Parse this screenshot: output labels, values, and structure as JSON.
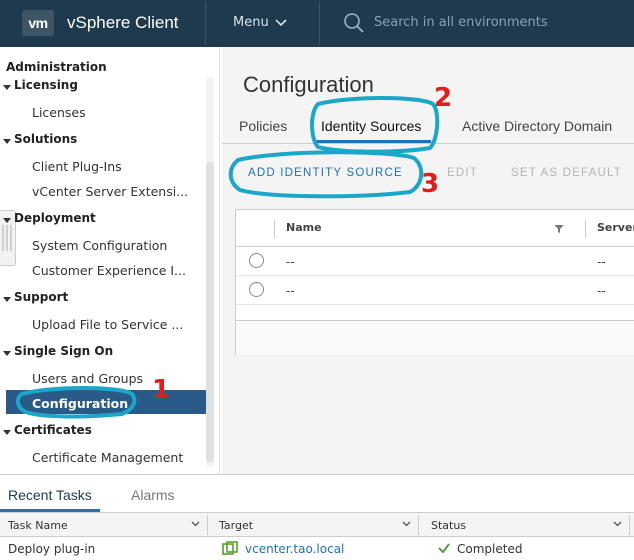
{
  "header": {
    "logo": "vm",
    "title": "vSphere Client",
    "menu_label": "Menu",
    "search_placeholder": "Search in all environments"
  },
  "sidebar": {
    "title": "Administration",
    "sections": [
      {
        "label": "Licensing",
        "items": [
          "Licenses"
        ]
      },
      {
        "label": "Solutions",
        "items": [
          "Client Plug-Ins",
          "vCenter Server Extensi..."
        ]
      },
      {
        "label": "Deployment",
        "items": [
          "System Configuration",
          "Customer Experience I..."
        ]
      },
      {
        "label": "Support",
        "items": [
          "Upload File to Service ..."
        ]
      },
      {
        "label": "Single Sign On",
        "items": [
          "Users and Groups",
          "Configuration"
        ]
      },
      {
        "label": "Certificates",
        "items": [
          "Certificate Management"
        ]
      }
    ],
    "active_item": "Configuration"
  },
  "main": {
    "title": "Configuration",
    "tabs": [
      "Policies",
      "Identity Sources",
      "Active Directory Domain"
    ],
    "active_tab": "Identity Sources",
    "actions": {
      "add": "ADD IDENTITY SOURCE",
      "edit": "EDIT",
      "set_default": "SET AS DEFAULT"
    },
    "grid": {
      "columns": [
        "Name",
        "Server"
      ],
      "rows": [
        {
          "name": "--",
          "server": "--"
        },
        {
          "name": "--",
          "server": "--"
        }
      ]
    }
  },
  "annotations": [
    "1",
    "2",
    "3"
  ],
  "bottom_panel": {
    "tabs": [
      "Recent Tasks",
      "Alarms"
    ],
    "columns": [
      "Task Name",
      "Target",
      "Status"
    ],
    "rows": [
      {
        "task": "Deploy plug-in",
        "target": "vcenter.tao.local",
        "status": "Completed"
      }
    ]
  },
  "colors": {
    "header_bg": "#1f3a4d",
    "active_nav": "#2a5a88",
    "accent": "#1f72b8",
    "annotation_circle": "#1aa7c9",
    "annotation_number": "#e31b1b",
    "success": "#3e9a2a"
  }
}
